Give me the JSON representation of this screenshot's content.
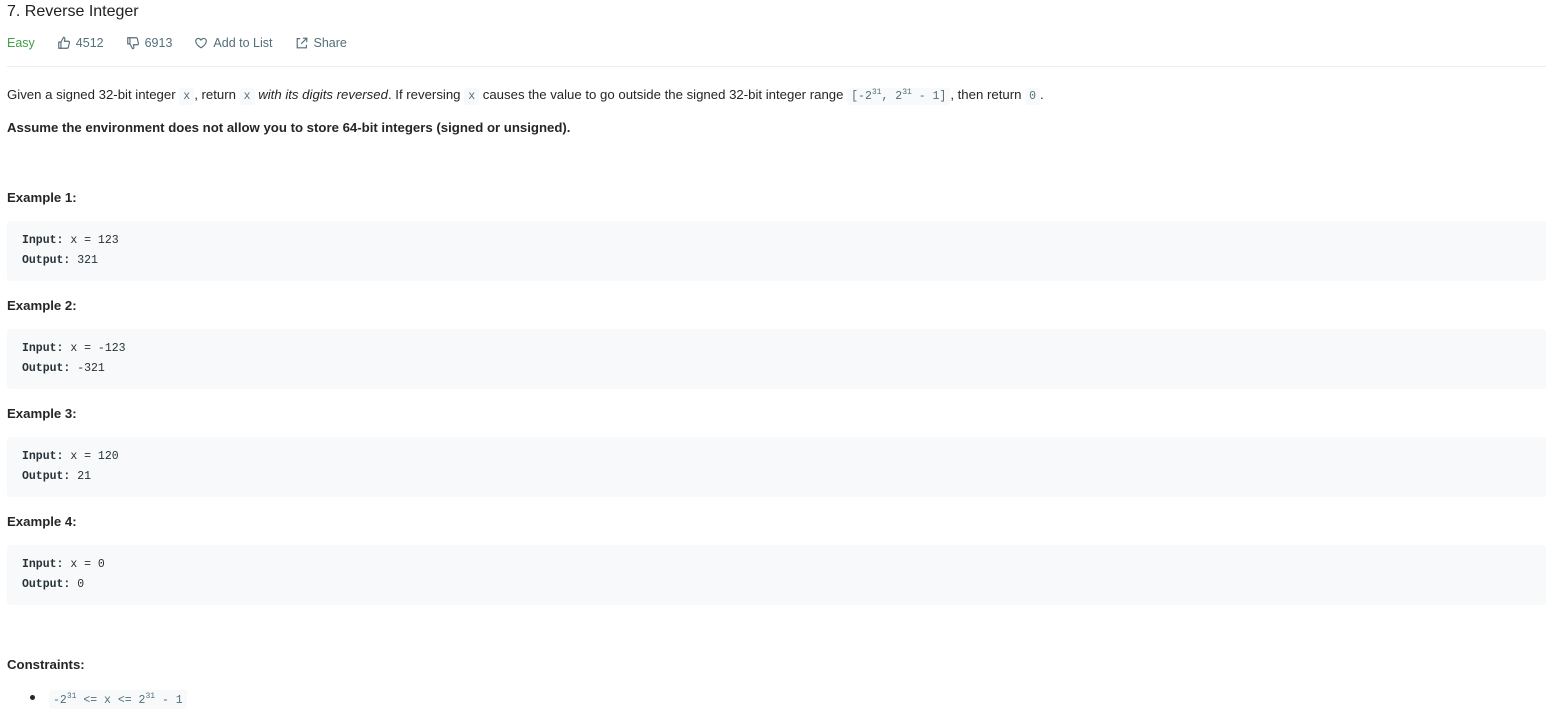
{
  "problem": {
    "title": "7. Reverse Integer",
    "difficulty": "Easy",
    "likes": "4512",
    "dislikes": "6913",
    "add_to_list": "Add to List",
    "share": "Share"
  },
  "description": {
    "p1_a": "Given a signed 32-bit integer ",
    "p1_var1": "x",
    "p1_b": ", return ",
    "p1_var2": "x",
    "p1_em": "with its digits reversed",
    "p1_c": ". If reversing ",
    "p1_var3": "x",
    "p1_d": " causes the value to go outside the signed 32-bit integer range ",
    "range_a": "[-2",
    "range_sup1": "31",
    "range_b": ", 2",
    "range_sup2": "31",
    "range_c": " - 1]",
    "p1_e": ", then return ",
    "p1_zero": "0",
    "p1_f": ".",
    "assume": "Assume the environment does not allow you to store 64-bit integers (signed or unsigned)."
  },
  "examples": [
    {
      "title": "Example 1:",
      "input_label": "Input:",
      "input_value": " x = 123",
      "output_label": "Output:",
      "output_value": " 321"
    },
    {
      "title": "Example 2:",
      "input_label": "Input:",
      "input_value": " x = -123",
      "output_label": "Output:",
      "output_value": " -321"
    },
    {
      "title": "Example 3:",
      "input_label": "Input:",
      "input_value": " x = 120",
      "output_label": "Output:",
      "output_value": " 21"
    },
    {
      "title": "Example 4:",
      "input_label": "Input:",
      "input_value": " x = 0",
      "output_label": "Output:",
      "output_value": " 0"
    }
  ],
  "constraints": {
    "title": "Constraints:",
    "c1_a": "-2",
    "c1_sup1": "31",
    "c1_b": " <= x <= 2",
    "c1_sup2": "31",
    "c1_c": " - 1"
  },
  "colors": {
    "easy": "#43a047",
    "meta": "#546e7a",
    "code_bg": "#f7f9fa"
  },
  "icons": {
    "like": "thumbs-up-icon",
    "dislike": "thumbs-down-icon",
    "add": "heart-icon",
    "share": "share-icon"
  }
}
